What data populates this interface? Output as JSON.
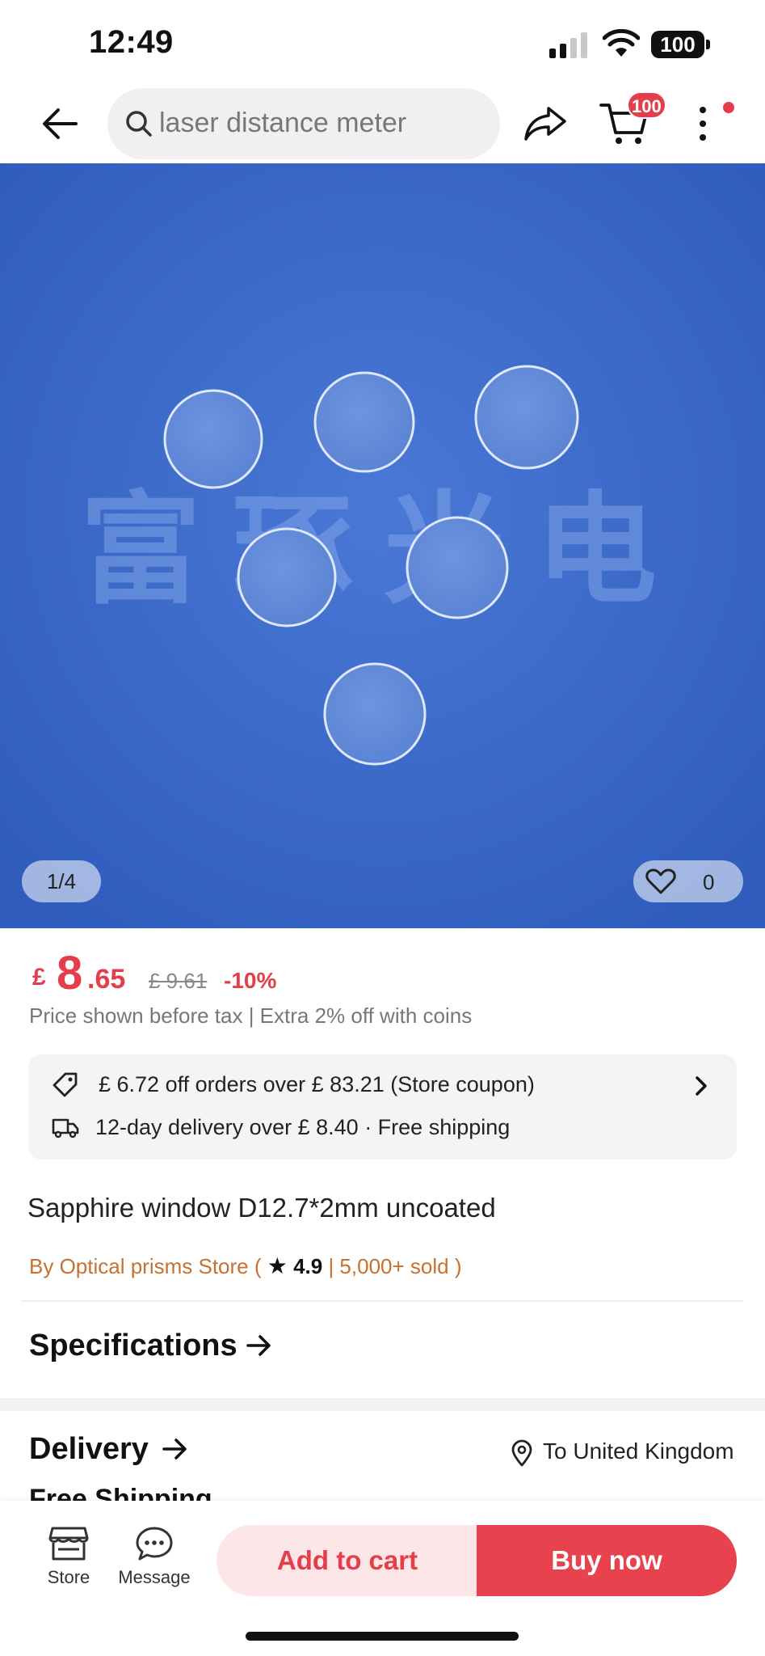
{
  "status_bar": {
    "time": "12:49",
    "battery": "100"
  },
  "nav": {
    "search_text": "laser distance meter",
    "cart_badge": "100"
  },
  "gallery": {
    "watermark": "富琢光电",
    "counter": "1/4",
    "favorites_count": "0",
    "background_color": "#3a68c8"
  },
  "price": {
    "currency": "£",
    "main": "8",
    "decimal": ".65",
    "original": "£ 9.61",
    "discount": "-10%",
    "tax_note": "Price shown before tax | Extra 2% off with coins"
  },
  "coupon": {
    "coupon_text": "£ 6.72 off orders over  £ 83.21 (Store coupon)",
    "delivery_text": "12-day delivery over  £ 8.40 · Free shipping"
  },
  "product": {
    "title": "Sapphire window D12.7*2mm uncoated",
    "store_prefix": "By Optical prisms Store ( ",
    "rating": "4.9",
    "sold": " | 5,000+ sold )"
  },
  "sections": {
    "specifications": "Specifications",
    "delivery": "Delivery",
    "location": "To United Kingdom",
    "free_shipping": "Free Shipping"
  },
  "bottom_bar": {
    "store_label": "Store",
    "message_label": "Message",
    "add_to_cart": "Add to cart",
    "buy_now": "Buy now"
  },
  "colors": {
    "accent": "#e53e4b",
    "store_link": "#c9702e"
  }
}
